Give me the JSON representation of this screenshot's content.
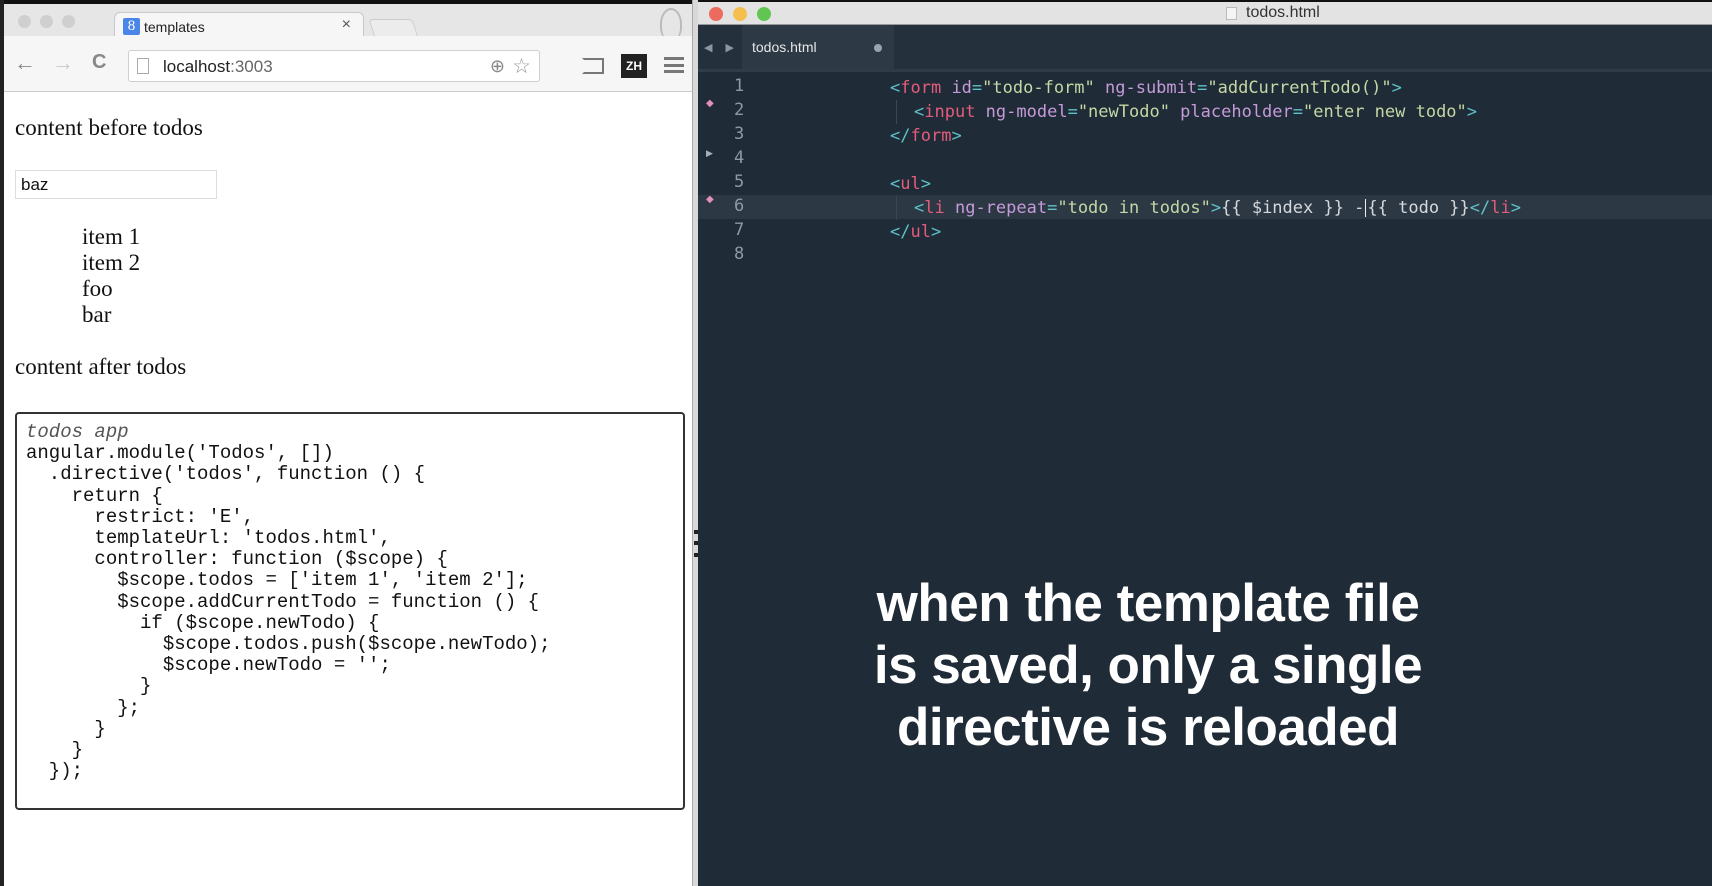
{
  "browser": {
    "tab": {
      "favicon": "8",
      "title": "templates",
      "close": "×"
    },
    "toolbar": {
      "back_icon": "←",
      "forward_icon": "→",
      "reload_icon": "C",
      "url_host": "localhost",
      "url_port": ":3003",
      "zoom_icon": "⊕",
      "bookmark_icon": "☆",
      "extension_label": "ZH"
    },
    "page": {
      "content_before": "content before todos",
      "input_value": "baz",
      "input_placeholder": "enter new todo",
      "todos": [
        "item 1",
        "item 2",
        "foo",
        "bar"
      ],
      "content_after": "content after todos",
      "code_caption": "todos app",
      "code_lines": [
        "angular.module('Todos', [])",
        "  .directive('todos', function () {",
        "    return {",
        "      restrict: 'E',",
        "      templateUrl: 'todos.html',",
        "      controller: function ($scope) {",
        "        $scope.todos = ['item 1', 'item 2'];",
        "        $scope.addCurrentTodo = function () {",
        "          if ($scope.newTodo) {",
        "            $scope.todos.push($scope.newTodo);",
        "            $scope.newTodo = '';",
        "          }",
        "        };",
        "      }",
        "    }",
        "  });"
      ]
    }
  },
  "editor": {
    "window_title": "todos.html",
    "tab_label": "todos.html",
    "tab_dirty": true,
    "traffic_colors": {
      "close": "#ed6a5e",
      "minimize": "#f5bf4f",
      "maximize": "#61c554"
    },
    "line_numbers": [
      "1",
      "2",
      "3",
      "4",
      "5",
      "6",
      "7",
      "8"
    ],
    "modified_lines": [
      2,
      6
    ],
    "current_line": 6,
    "lines": {
      "l1": {
        "open": "<",
        "tag": "form",
        "a1": " id",
        "eq1": "=",
        "v1": "\"todo-form\"",
        "a2": " ng-submit",
        "eq2": "=",
        "v2": "\"addCurrentTodo()\"",
        "close": ">"
      },
      "l2": {
        "open": "<",
        "tag": "input",
        "a1": " ng-model",
        "eq1": "=",
        "v1": "\"newTodo\"",
        "a2": " placeholder",
        "eq2": "=",
        "v2": "\"enter new todo\"",
        "close": ">"
      },
      "l3": {
        "open": "</",
        "tag": "form",
        "close": ">"
      },
      "l5": {
        "open": "<",
        "tag": "ul",
        "close": ">"
      },
      "l6": {
        "open": "<",
        "tag": "li",
        "a1": " ng-repeat",
        "eq1": "=",
        "v1": "\"todo in todos\"",
        "close": ">",
        "text1": "{{ $index }} -",
        "text2": "{{ todo }}",
        "end_open": "</",
        "end_tag": "li",
        "end_close": ">"
      },
      "l7": {
        "open": "</",
        "tag": "ul",
        "close": ">"
      }
    }
  },
  "caption": {
    "lines": [
      "when the template file",
      "is saved, only a single",
      "directive is reloaded"
    ]
  }
}
